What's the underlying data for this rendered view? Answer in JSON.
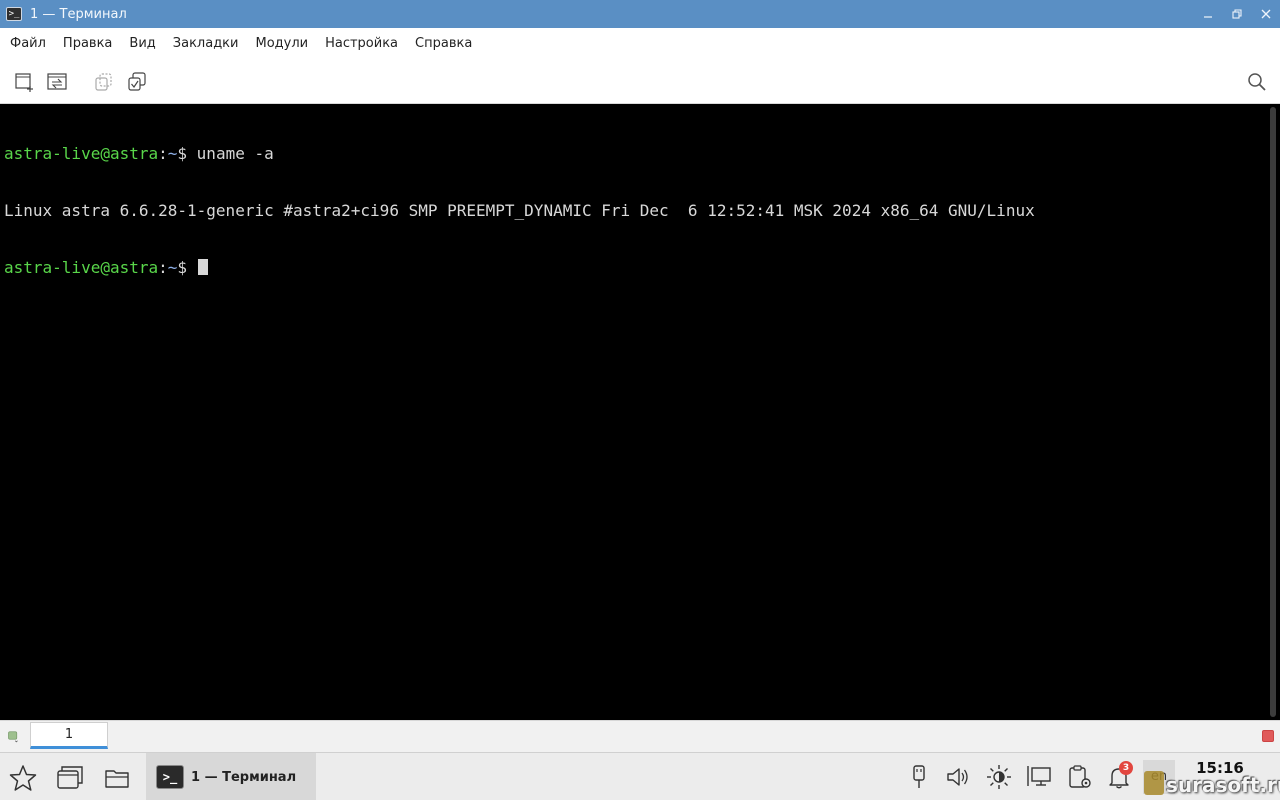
{
  "window": {
    "title": "1 — Терминал",
    "app_icon_glyph": ">_",
    "controls": [
      "minimize",
      "maximize",
      "close"
    ]
  },
  "menu": {
    "items": [
      "Файл",
      "Правка",
      "Вид",
      "Закладки",
      "Модули",
      "Настройка",
      "Справка"
    ]
  },
  "toolbar": {
    "buttons": [
      "new-tab-icon",
      "split-view-icon",
      "copy-icon",
      "paste-icon",
      "search-icon"
    ]
  },
  "terminal": {
    "line1": {
      "prompt": "astra-live@astra",
      "sep": ":",
      "path": "~",
      "dollar": "$ ",
      "command": "uname -a"
    },
    "line2": "Linux astra 6.6.28-1-generic #astra2+ci96 SMP PREEMPT_DYNAMIC Fri Dec  6 12:52:41 MSK 2024 x86_64 GNU/Linux",
    "line3": {
      "prompt": "astra-live@astra",
      "sep": ":",
      "path": "~",
      "dollar": "$ "
    }
  },
  "tabs": {
    "active_label": "1"
  },
  "taskbar": {
    "task_label": "1 — Терминал",
    "task_glyph": ">_",
    "notification_count": "3",
    "language": "en",
    "clock": "15:16",
    "watermark": "surasoft.ru"
  },
  "colors": {
    "titlebar": "#5a8fc4",
    "prompt_green": "#59d64a",
    "path_blue": "#8fb0e8",
    "tab_accent": "#3f8fd8"
  }
}
